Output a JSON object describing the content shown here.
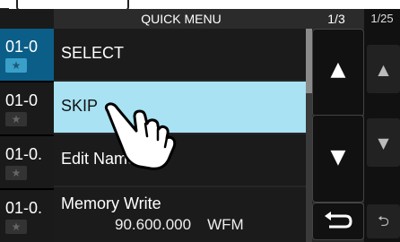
{
  "window": {
    "title": "QUICK MENU",
    "page_indicator": "1/3",
    "outer_page_indicator": "1/25"
  },
  "background_list": [
    {
      "label": "01-0",
      "selected": true
    },
    {
      "label": "01-0",
      "selected": false
    },
    {
      "label": "01-0.",
      "selected": false
    },
    {
      "label": "01-0.",
      "selected": false
    }
  ],
  "menu": {
    "items": [
      {
        "label": "SELECT"
      },
      {
        "label": "SKIP"
      },
      {
        "label": "Edit Name"
      },
      {
        "label": "Memory Write",
        "frequency": "90.600.000",
        "mode": "WFM"
      }
    ],
    "active_item": "SKIP"
  },
  "icons": {
    "up": "up-arrow-icon",
    "down": "down-arrow-icon",
    "back": "return-icon",
    "star": "star-icon",
    "hand": "pointing-hand-icon"
  },
  "colors": {
    "accent_highlight": "#a8e2f3",
    "selected_row": "#0b5e88"
  }
}
